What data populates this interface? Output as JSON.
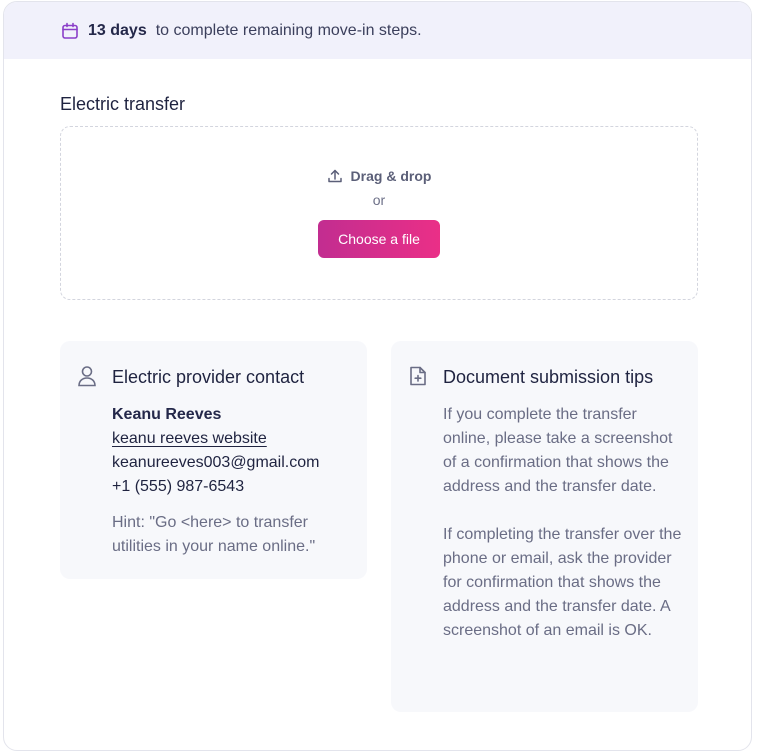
{
  "banner": {
    "days": "13 days",
    "message": "to complete remaining move-in steps."
  },
  "upload": {
    "title": "Electric transfer",
    "drag_label": "Drag & drop",
    "or_label": "or",
    "button_label": "Choose a file"
  },
  "contact": {
    "title": "Electric provider contact",
    "name": "Keanu Reeves",
    "website_label": "keanu reeves website",
    "email": "keanureeves003@gmail.com",
    "phone": "+1 (555) 987-6543",
    "hint": "Hint: \"Go <here> to transfer utilities in your name online.\""
  },
  "tips": {
    "title": "Document submission tips",
    "paragraph1": "If you complete the transfer online, please take a screenshot of a confirmation that shows the address and the transfer date.",
    "paragraph2": "If completing the transfer over the phone or email, ask the provider for confirmation that shows the address and the transfer date. A screenshot of an email is OK."
  },
  "icons": {
    "banner": "calendar-icon",
    "upload": "upload-icon",
    "contact": "person-icon",
    "tips": "document-plus-icon"
  },
  "colors": {
    "accent_start": "#c22d90",
    "accent_end": "#ea2f87",
    "banner_bg": "#f1f1fb",
    "icon_purple": "#8b3fc9"
  }
}
